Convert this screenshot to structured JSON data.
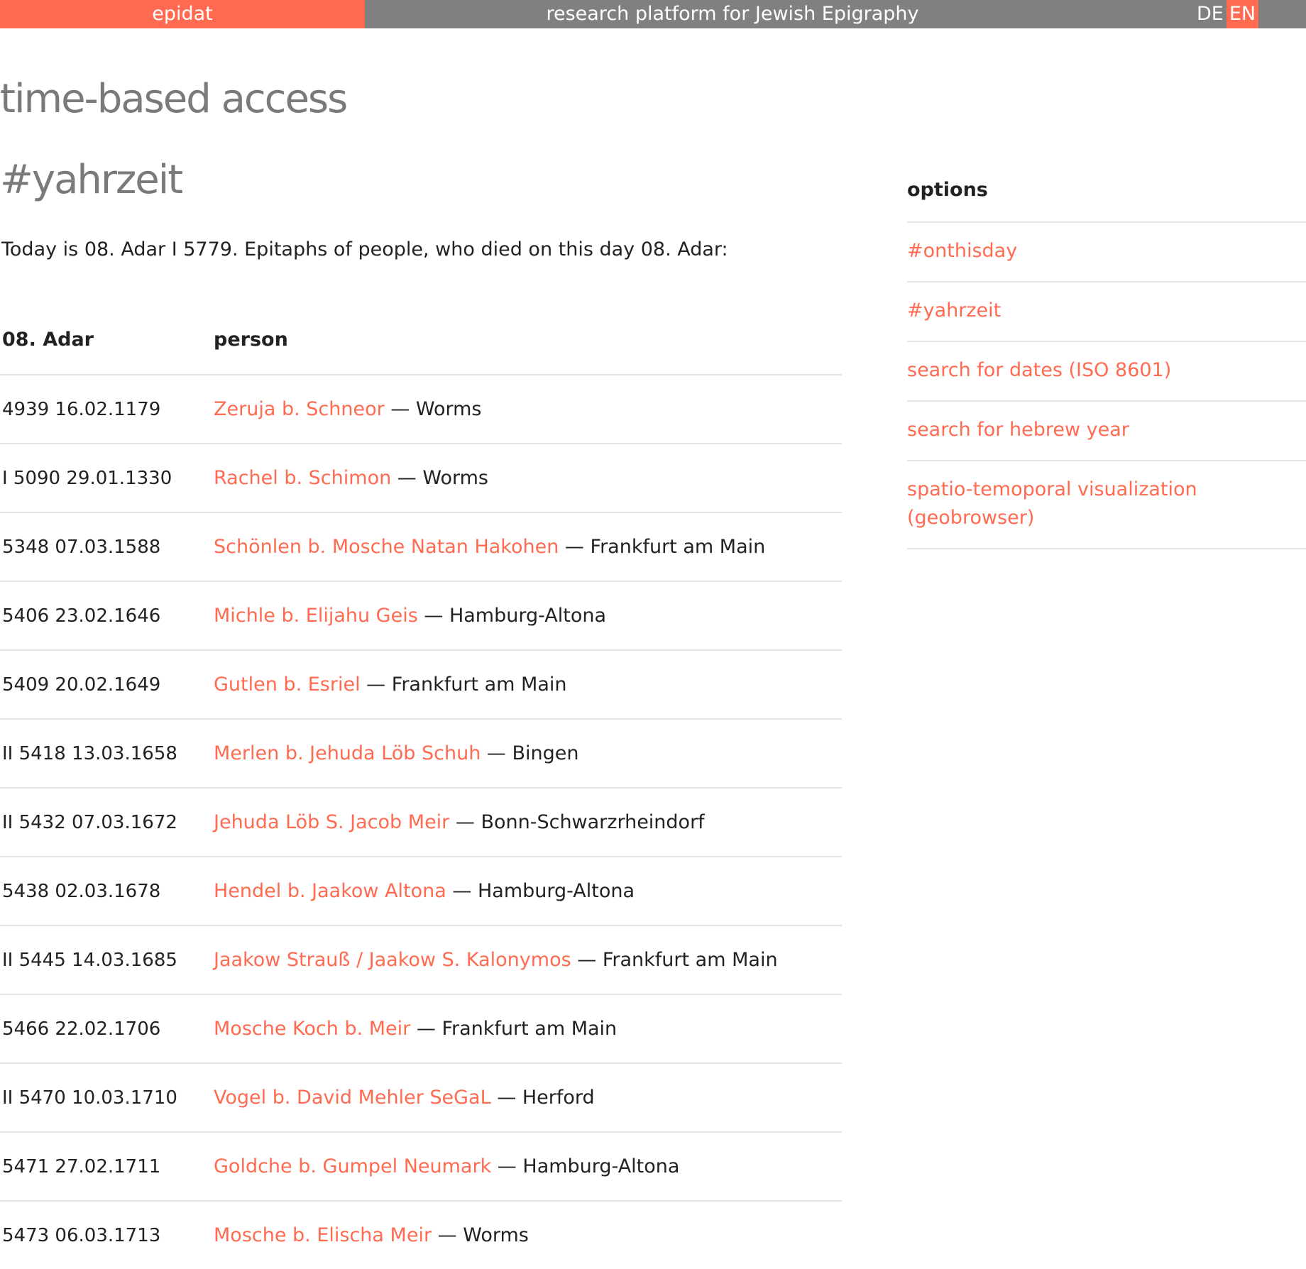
{
  "header": {
    "brand": "epidat",
    "platform_title": "research platform for Jewish Epigraphy",
    "languages": [
      "DE",
      "EN"
    ],
    "active_language": "EN"
  },
  "page_title": "time-based access",
  "section_title": "#yahrzeit",
  "intro": "Today is 08. Adar I 5779. Epitaphs of people, who died on this day 08. Adar:",
  "table": {
    "headers": {
      "date": "08. Adar",
      "person": "person"
    },
    "rows": [
      {
        "date": "4939 16.02.1179",
        "person": "Zeruja b. Schneor",
        "sep": " — ",
        "place": "Worms"
      },
      {
        "date": "I 5090 29.01.1330",
        "person": "Rachel b. Schimon",
        "sep": " — ",
        "place": "Worms"
      },
      {
        "date": "5348 07.03.1588",
        "person": "Schönlen b. Mosche Natan Hakohen",
        "sep": " — ",
        "place": "Frankfurt am Main"
      },
      {
        "date": "5406 23.02.1646",
        "person": "Michle b. Elijahu Geis",
        "sep": " — ",
        "place": "Hamburg-Altona"
      },
      {
        "date": "5409 20.02.1649",
        "person": "Gutlen b. Esriel",
        "sep": " — ",
        "place": "Frankfurt am Main"
      },
      {
        "date": "II 5418 13.03.1658",
        "person": "Merlen b. Jehuda Löb Schuh",
        "sep": " — ",
        "place": "Bingen"
      },
      {
        "date": "II 5432 07.03.1672",
        "person": "Jehuda Löb S. Jacob Meir",
        "sep": " — ",
        "place": "Bonn-Schwarzrheindorf"
      },
      {
        "date": "5438 02.03.1678",
        "person": "Hendel b. Jaakow Altona",
        "sep": " — ",
        "place": "Hamburg-Altona"
      },
      {
        "date": "II 5445 14.03.1685",
        "person": "Jaakow Strauß / Jaakow S. Kalonymos",
        "sep": " — ",
        "place": "Frankfurt am Main"
      },
      {
        "date": "5466 22.02.1706",
        "person": "Mosche Koch b. Meir",
        "sep": " — ",
        "place": "Frankfurt am Main"
      },
      {
        "date": "II 5470 10.03.1710",
        "person": "Vogel b. David Mehler SeGaL",
        "sep": " — ",
        "place": "Herford"
      },
      {
        "date": "5471 27.02.1711",
        "person": "Goldche b. Gumpel Neumark",
        "sep": " — ",
        "place": "Hamburg-Altona"
      },
      {
        "date": "5473 06.03.1713",
        "person": "Mosche b. Elischa Meir",
        "sep": " — ",
        "place": "Worms"
      }
    ]
  },
  "sidebar": {
    "title": "options",
    "items": [
      {
        "label": "#onthisday"
      },
      {
        "label": "#yahrzeit"
      },
      {
        "label": "search for dates (ISO 8601)"
      },
      {
        "label": "search for hebrew year"
      },
      {
        "label": "spatio-temoporal visualization (geobrowser)"
      }
    ]
  },
  "colors": {
    "accent": "#ff6a50",
    "topbar": "#808080",
    "heading": "#7a7a7a",
    "text": "#222222",
    "divider": "#e4e4e4"
  }
}
